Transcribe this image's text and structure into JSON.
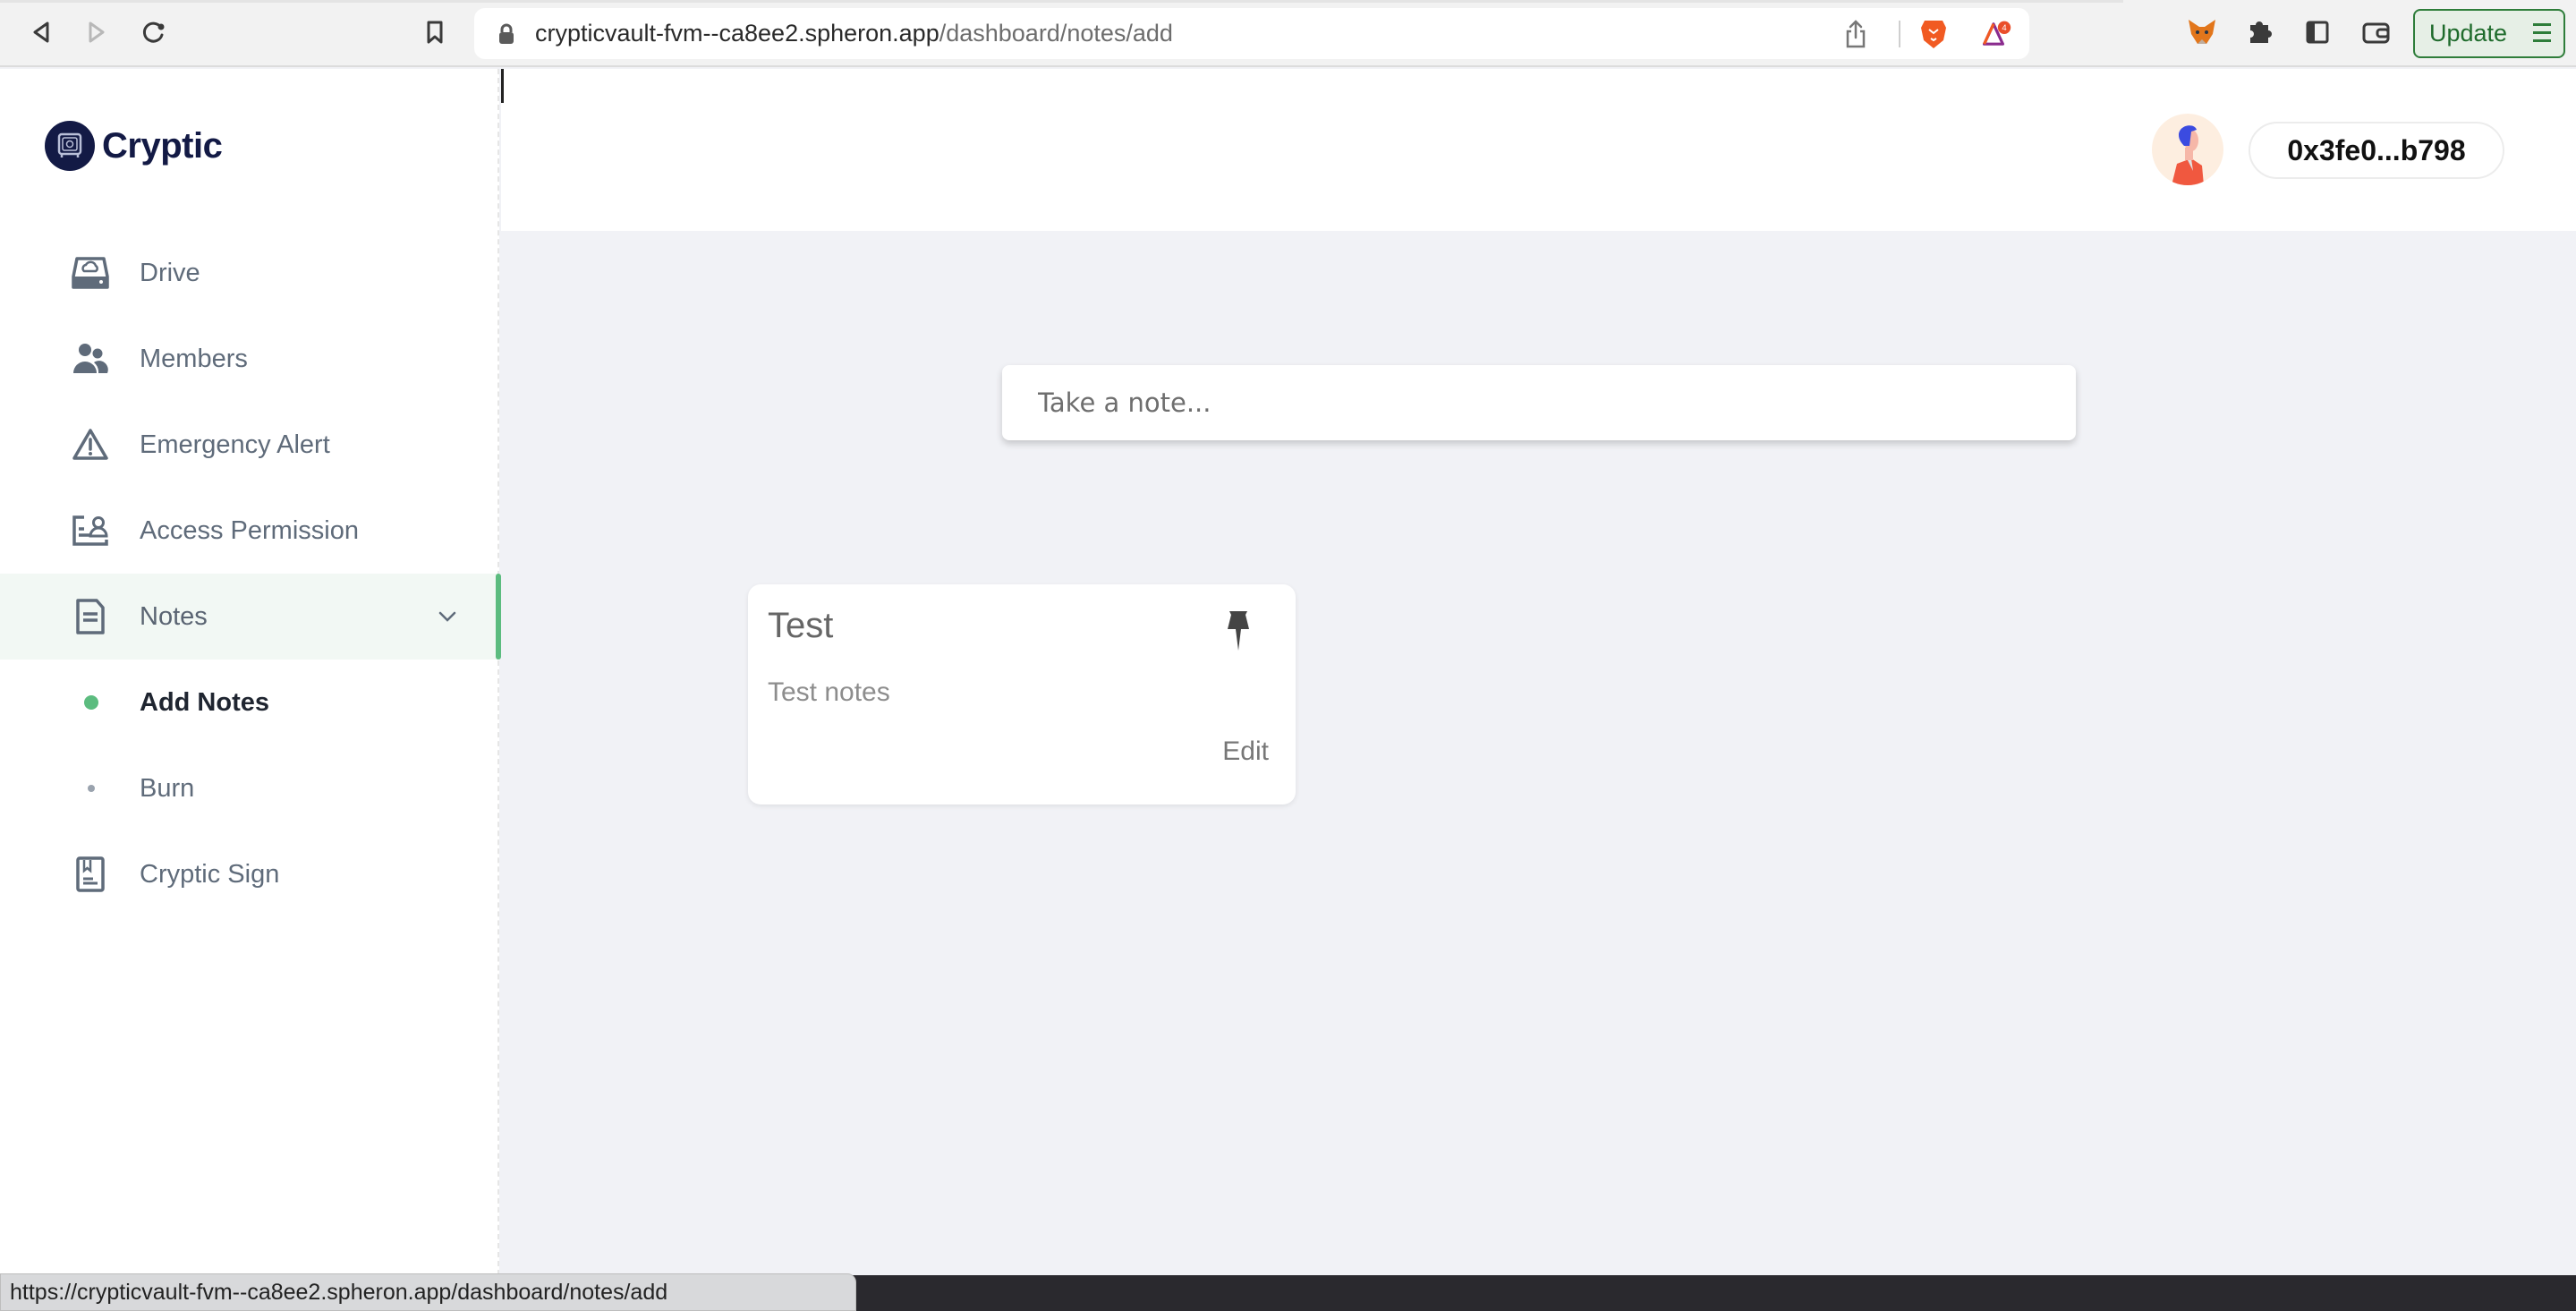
{
  "browser": {
    "url_host": "crypticvault-fvm--ca8ee2.spheron.app",
    "url_path": "/dashboard/notes/add",
    "update_label": "Update",
    "notification_badge": "4",
    "icons": {
      "back": "back-arrow-icon",
      "forward": "forward-arrow-icon",
      "reload": "reload-icon",
      "bookmark": "bookmark-icon",
      "lock": "lock-icon",
      "share": "share-icon",
      "brave": "brave-lion-icon",
      "rewards": "brave-rewards-icon",
      "metamask": "metamask-fox-icon",
      "extensions": "puzzle-piece-icon",
      "sidebar": "sidebar-toggle-icon",
      "wallet": "wallet-icon",
      "menu": "hamburger-menu-icon"
    },
    "status_url": "https://crypticvault-fvm--ca8ee2.spheron.app/dashboard/notes/add"
  },
  "app": {
    "brand": "Cryptic",
    "wallet_address": "0x3fe0...b798",
    "sidebar": {
      "items": [
        {
          "label": "Drive",
          "icon": "drive-cloud-icon"
        },
        {
          "label": "Members",
          "icon": "members-icon"
        },
        {
          "label": "Emergency Alert",
          "icon": "warning-triangle-icon"
        },
        {
          "label": "Access Permission",
          "icon": "access-permission-icon"
        },
        {
          "label": "Notes",
          "icon": "document-icon",
          "expanded": true,
          "active": true
        },
        {
          "label": "Add Notes",
          "sub": true,
          "current": true
        },
        {
          "label": "Burn",
          "sub": true
        },
        {
          "label": "Cryptic Sign",
          "icon": "sign-bookmark-icon"
        }
      ]
    },
    "note_input": {
      "placeholder": "Take a note...",
      "value": ""
    },
    "notes": [
      {
        "title": "Test",
        "body": "Test notes",
        "edit_label": "Edit",
        "pinned": true
      }
    ],
    "colors": {
      "accent_green": "#5cbc7f",
      "brand_navy": "#131a45",
      "update_green": "#2e7d3a"
    }
  }
}
